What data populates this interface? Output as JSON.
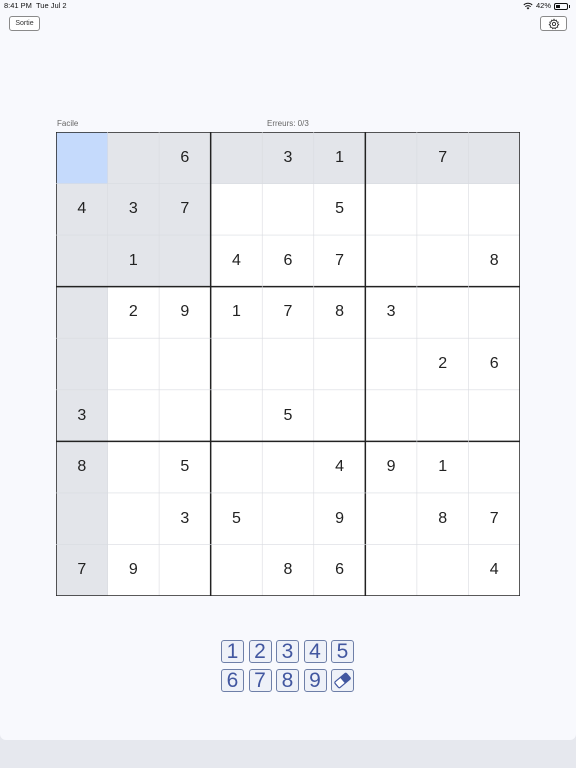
{
  "status": {
    "time": "8:41 PM",
    "date": "Tue Jul 2",
    "battery": "42%"
  },
  "header": {
    "exit_label": "Sortie",
    "settings_icon": "gear-icon"
  },
  "game": {
    "difficulty": "Facile",
    "errors": "Erreurs: 0/3",
    "selected_cell": [
      0,
      0
    ],
    "colors": {
      "selected": "#c5dafc",
      "highlight": "#e3e5ea",
      "cell": "#ffffff",
      "digit": "#222222",
      "accent": "#4257a0"
    },
    "grid": [
      [
        0,
        0,
        6,
        0,
        3,
        1,
        0,
        7,
        0
      ],
      [
        4,
        3,
        7,
        0,
        0,
        5,
        0,
        0,
        0
      ],
      [
        0,
        1,
        0,
        4,
        6,
        7,
        0,
        0,
        8
      ],
      [
        0,
        2,
        9,
        1,
        7,
        8,
        3,
        0,
        0
      ],
      [
        0,
        0,
        0,
        0,
        0,
        0,
        0,
        2,
        6
      ],
      [
        3,
        0,
        0,
        0,
        5,
        0,
        0,
        0,
        0
      ],
      [
        8,
        0,
        5,
        0,
        0,
        4,
        9,
        1,
        0
      ],
      [
        0,
        0,
        3,
        5,
        0,
        9,
        0,
        8,
        7
      ],
      [
        7,
        9,
        0,
        0,
        8,
        6,
        0,
        0,
        4
      ]
    ]
  },
  "numpad": {
    "keys": [
      "1",
      "2",
      "3",
      "4",
      "5",
      "6",
      "7",
      "8",
      "9"
    ],
    "eraser_icon": "eraser-icon"
  }
}
